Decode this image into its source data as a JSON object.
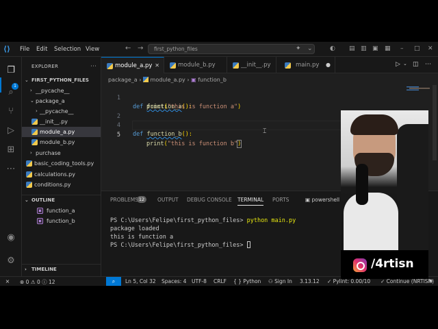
{
  "titlebar": {
    "menus": [
      "File",
      "Edit",
      "Selection",
      "View"
    ],
    "search_text": "first_python_files"
  },
  "activity_bar": {
    "explorer_badge": "1"
  },
  "sidebar": {
    "title": "EXPLORER",
    "root_folder": "FIRST_PYTHON_FILES",
    "tree": [
      {
        "label": "__pycache__",
        "level": 1,
        "type": "folder"
      },
      {
        "label": "package_a",
        "level": 1,
        "type": "folder-open"
      },
      {
        "label": "__pycache__",
        "level": 2,
        "type": "folder"
      },
      {
        "label": "__init__.py",
        "level": 2,
        "type": "py"
      },
      {
        "label": "module_a.py",
        "level": 2,
        "type": "py",
        "selected": true
      },
      {
        "label": "module_b.py",
        "level": 2,
        "type": "py"
      },
      {
        "label": "purchase",
        "level": 1,
        "type": "folder"
      },
      {
        "label": "basic_coding_tools.py",
        "level": 1,
        "type": "py"
      },
      {
        "label": "calculations.py",
        "level": 1,
        "type": "py"
      },
      {
        "label": "conditions.py",
        "level": 1,
        "type": "py"
      }
    ],
    "outline_title": "OUTLINE",
    "outline_items": [
      "function_a",
      "function_b"
    ],
    "timeline_title": "TIMELINE"
  },
  "tabs": [
    {
      "label": "module_a.py",
      "active": true
    },
    {
      "label": "module_b.py",
      "active": false
    },
    {
      "label": "__init__.py",
      "active": false
    },
    {
      "label": "main.py",
      "active": false,
      "modified": true
    }
  ],
  "breadcrumb": {
    "folder": "package_a",
    "file": "module_a.py",
    "symbol": "function_b"
  },
  "editor": {
    "line_numbers": [
      "1",
      "2",
      "4",
      "5"
    ],
    "lines": {
      "l1_kw": "def",
      "l1_name": "function_a",
      "l1_tail": "():",
      "l2_call": "print",
      "l2_str": "\"this is function a\"",
      "l4_kw": "def",
      "l4_name": "function_b",
      "l4_tail": "():",
      "l5_call": "print",
      "l5_str": "\"this is function b\""
    }
  },
  "panel": {
    "tabs": [
      "PROBLEMS",
      "OUTPUT",
      "DEBUG CONSOLE",
      "TERMINAL",
      "PORTS"
    ],
    "problems_count": "12",
    "active_tab": "TERMINAL",
    "shell_label": "powershell",
    "terminal": {
      "prompt1": "PS C:\\Users\\Felipe\\first_python_files>",
      "command1": "python main.py",
      "output1": "package loaded",
      "output2": "this is function a",
      "prompt2": "PS C:\\Users\\Felipe\\first_python_files>"
    }
  },
  "statusbar": {
    "errors": "0",
    "warnings": "0",
    "info": "12",
    "position": "Ln 5, Col 32",
    "spaces": "Spaces: 4",
    "encoding": "UTF-8",
    "eol": "CRLF",
    "language": "Python",
    "sign_in": "Sign In",
    "python_version": "3.13.12",
    "pylint": "Pylint: 0.00/10",
    "continue": "Continue (NRTISN)"
  },
  "overlay": {
    "instagram_handle": "/4rtisn"
  },
  "colors": {
    "accent": "#0078d4",
    "keyword": "#569cd6",
    "function": "#dcdcaa",
    "string": "#ce9178"
  }
}
